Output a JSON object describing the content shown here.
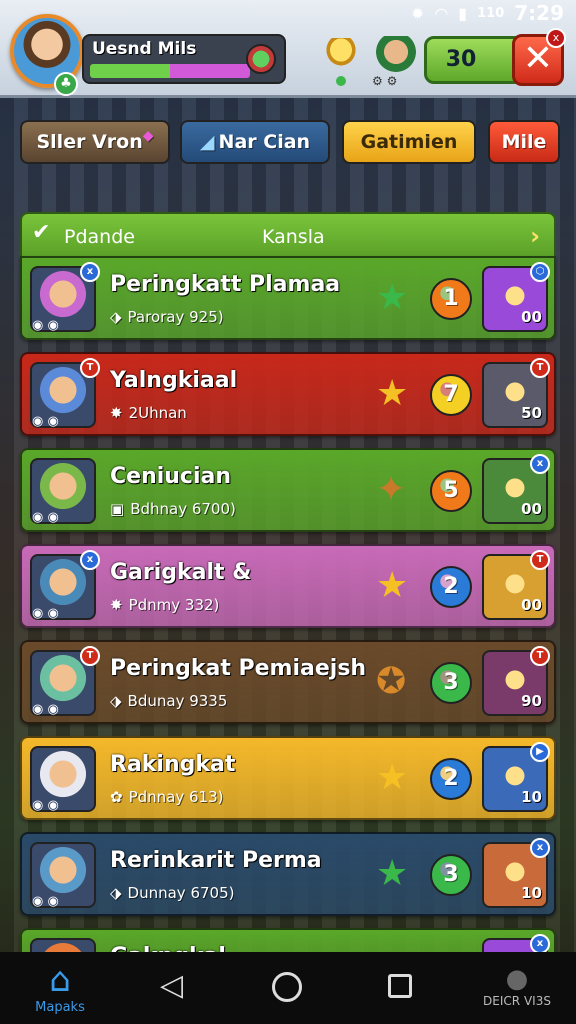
{
  "status_bar": {
    "carrier": "110",
    "time": "7:29"
  },
  "header": {
    "player_name": "Uesnd Mils",
    "xp_green_fraction": 0.5,
    "xp_pink_fraction": 0.5,
    "gem_count": "30",
    "close_label": "✕",
    "close_badge": "x"
  },
  "tabs": [
    {
      "label": "Sller Vron",
      "color": "#7a6040"
    },
    {
      "label": "Nar Cian",
      "color": "#2e5a8c"
    },
    {
      "label": "Gatimien",
      "color": "#f5bc2a"
    },
    {
      "label": "Mile",
      "color": "#e03a22"
    }
  ],
  "list_header": {
    "left": "Pdande",
    "middle": "Kansla",
    "chevron": "›"
  },
  "rows": [
    {
      "name": "Peringkatt Plamaa",
      "sub_icon": "⬗",
      "sub": "Paroray 925)",
      "star": "★",
      "star_color": "#3ab84a",
      "rank": "1",
      "rank_color": "#f07a1a",
      "item_count": "00",
      "item_badge": "⬡",
      "badge": "x",
      "badge_color": "#2a6ad8",
      "row_color": "#5aa82a",
      "avatar_color": "#c86ad0",
      "item_color": "#9a4ad8"
    },
    {
      "name": "Yalngkiaal",
      "sub_icon": "✸",
      "sub": "2Uhnan",
      "star": "★",
      "star_color": "#f5c024",
      "rank": "7",
      "rank_color": "#f5d024",
      "item_count": "50",
      "item_badge": "T",
      "badge": "T",
      "badge_color": "#d02a1a",
      "row_color": "#c8281a",
      "avatar_color": "#5a8ad8",
      "item_color": "#5a5a6a"
    },
    {
      "name": "Ceniucian",
      "sub_icon": "▣",
      "sub": "Bdhnay 6700)",
      "star": "✦",
      "star_color": "#c87a2a",
      "rank": "5",
      "rank_color": "#f07a1a",
      "item_count": "00",
      "item_badge": "x",
      "badge": "",
      "badge_color": "#2a6ad8",
      "row_color": "#5aa82a",
      "avatar_color": "#7ab84a",
      "item_color": "#4a8a3a"
    },
    {
      "name": "Garigkalt &",
      "sub_icon": "✸",
      "sub": "Pdnmy 332)",
      "star": "★",
      "star_color": "#f5c024",
      "rank": "2",
      "rank_color": "#2a7ad8",
      "item_count": "00",
      "item_badge": "T",
      "badge": "x",
      "badge_color": "#2a6ad8",
      "row_color": "#c86ab8",
      "avatar_color": "#4a8ab8",
      "item_color": "#d8a030"
    },
    {
      "name": "Peringkat Pemiaejsh",
      "sub_icon": "⬗",
      "sub": "Bdunay 9335",
      "star": "✪",
      "star_color": "#d88a2a",
      "rank": "3",
      "rank_color": "#3ab84a",
      "item_count": "90",
      "item_badge": "T",
      "badge": "T",
      "badge_color": "#d02a1a",
      "row_color": "#6a4a2a",
      "avatar_color": "#6ac0a0",
      "item_color": "#7a3a6a"
    },
    {
      "name": "Rakingkat",
      "sub_icon": "✿",
      "sub": "Pdnnay 613)",
      "star": "★",
      "star_color": "#f5c024",
      "rank": "2",
      "rank_color": "#2a7ad8",
      "item_count": "10",
      "item_badge": "▶",
      "badge": "",
      "badge_color": "#2a6ad8",
      "row_color": "#f5b82a",
      "avatar_color": "#e8e8f0",
      "item_color": "#3a6ab8"
    },
    {
      "name": "Rerinkarit Perma",
      "sub_icon": "⬗",
      "sub": "Dunnay 6705)",
      "star": "★",
      "star_color": "#3ab84a",
      "rank": "3",
      "rank_color": "#3ab84a",
      "item_count": "10",
      "item_badge": "x",
      "badge": "",
      "badge_color": "#2a6ad8",
      "row_color": "#2a4a6a",
      "avatar_color": "#5a9ac8",
      "item_color": "#c86a3a"
    },
    {
      "name": "Gakngkal",
      "sub_icon": "",
      "sub": "",
      "star": "",
      "star_color": "#f5c024",
      "rank": "",
      "rank_color": "#f07a1a",
      "item_count": "",
      "item_badge": "x",
      "badge": "",
      "badge_color": "#2a6ad8",
      "row_color": "#5aa82a",
      "avatar_color": "#e87a3a",
      "item_color": "#9a4ad8"
    }
  ],
  "navbar": {
    "home_label": "Mapaks",
    "profile_label": "DEICR VI3S"
  }
}
